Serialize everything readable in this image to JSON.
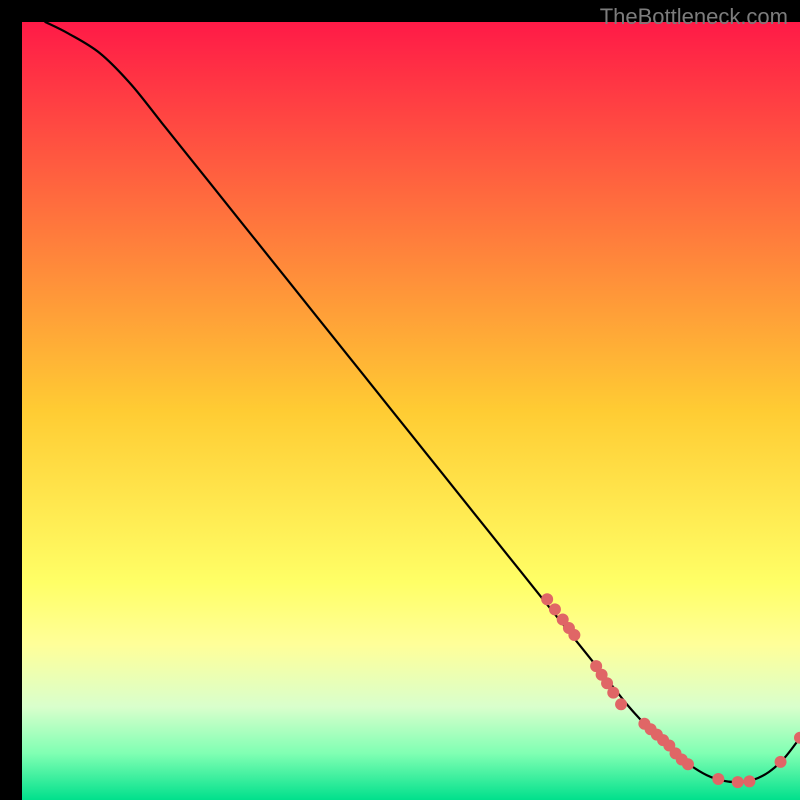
{
  "watermark": "TheBottleneck.com",
  "chart_data": {
    "type": "line",
    "title": "",
    "xlabel": "",
    "ylabel": "",
    "xlim": [
      0,
      100
    ],
    "ylim": [
      0,
      100
    ],
    "grid": false,
    "legend": false,
    "background_gradient_stops": [
      {
        "offset": 0.0,
        "color": "#ff1a47"
      },
      {
        "offset": 0.5,
        "color": "#ffcc33"
      },
      {
        "offset": 0.72,
        "color": "#ffff66"
      },
      {
        "offset": 0.8,
        "color": "#ffff99"
      },
      {
        "offset": 0.88,
        "color": "#d9ffcc"
      },
      {
        "offset": 0.94,
        "color": "#80ffb3"
      },
      {
        "offset": 1.0,
        "color": "#00e08c"
      }
    ],
    "curve": {
      "comment": "Monotone curve from upper-left toward a minimum near x≈86 then rising; values on 0–100 scale (y=0 bottom, y=100 top).",
      "x": [
        3,
        6,
        10,
        14,
        18,
        22,
        26,
        30,
        34,
        38,
        42,
        46,
        50,
        54,
        58,
        62,
        66,
        70,
        74,
        76,
        78,
        80,
        82,
        84,
        86,
        88,
        90,
        92,
        94,
        96,
        98,
        100
      ],
      "y": [
        100,
        98.5,
        96,
        92,
        87,
        82,
        77,
        72,
        67,
        62,
        57,
        52,
        47,
        42,
        37,
        32,
        27,
        22,
        17,
        14.5,
        12,
        9.8,
        7.8,
        6.0,
        4.4,
        3.2,
        2.5,
        2.3,
        2.6,
        3.6,
        5.4,
        8.0
      ]
    },
    "markers": {
      "comment": "Scatter markers along the lower-right portion of the curve.",
      "color": "#e06666",
      "radius_px": 6,
      "points": [
        {
          "x": 67.5,
          "y": 25.8
        },
        {
          "x": 68.5,
          "y": 24.5
        },
        {
          "x": 69.5,
          "y": 23.2
        },
        {
          "x": 70.3,
          "y": 22.1
        },
        {
          "x": 71.0,
          "y": 21.2
        },
        {
          "x": 73.8,
          "y": 17.2
        },
        {
          "x": 74.5,
          "y": 16.1
        },
        {
          "x": 75.2,
          "y": 15.0
        },
        {
          "x": 76.0,
          "y": 13.8
        },
        {
          "x": 77.0,
          "y": 12.3
        },
        {
          "x": 80.0,
          "y": 9.8
        },
        {
          "x": 80.8,
          "y": 9.1
        },
        {
          "x": 81.6,
          "y": 8.4
        },
        {
          "x": 82.4,
          "y": 7.7
        },
        {
          "x": 83.2,
          "y": 7.0
        },
        {
          "x": 84.0,
          "y": 6.0
        },
        {
          "x": 84.8,
          "y": 5.2
        },
        {
          "x": 85.6,
          "y": 4.6
        },
        {
          "x": 89.5,
          "y": 2.7
        },
        {
          "x": 92.0,
          "y": 2.3
        },
        {
          "x": 93.5,
          "y": 2.4
        },
        {
          "x": 97.5,
          "y": 4.9
        },
        {
          "x": 100.0,
          "y": 8.0
        }
      ]
    }
  }
}
